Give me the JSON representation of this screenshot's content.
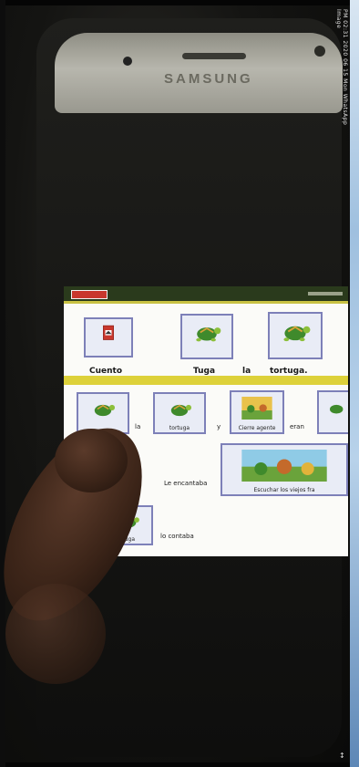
{
  "overlay": {
    "rotated_text": "PM 02:31 2020 06 15 Mon WhatsApp Image",
    "corner_mark": "↕"
  },
  "phone": {
    "brand": "SAMSUNG"
  },
  "app": {
    "title_labels": [],
    "top_row": [
      {
        "caption": "Cuento",
        "icon": "book-icon"
      },
      {
        "caption": "Tuga",
        "icon": "turtle-icon"
      },
      {
        "caption": "la",
        "icon": null
      },
      {
        "caption": "tortuga.",
        "icon": "turtle-icon"
      }
    ],
    "row2": [
      {
        "label": "",
        "icon": "turtle-icon"
      },
      {
        "label": "la",
        "icon": null
      },
      {
        "label": "tortuga",
        "icon": "turtle-icon"
      },
      {
        "label": "y",
        "icon": null
      },
      {
        "label": "Cierre agente",
        "icon": "scene-icon"
      },
      {
        "label": "eran",
        "icon": null
      },
      {
        "label": "",
        "icon": "turtle-icon"
      }
    ],
    "row3": [
      {
        "label": "Le encantaba",
        "icon": null
      },
      {
        "label": "Escuchar los viejos fra",
        "icon": "scene-icon"
      }
    ],
    "row4": [
      {
        "label": "Tuga",
        "icon": "turtle-icon"
      },
      {
        "label": "lo contaba",
        "icon": null
      }
    ]
  }
}
